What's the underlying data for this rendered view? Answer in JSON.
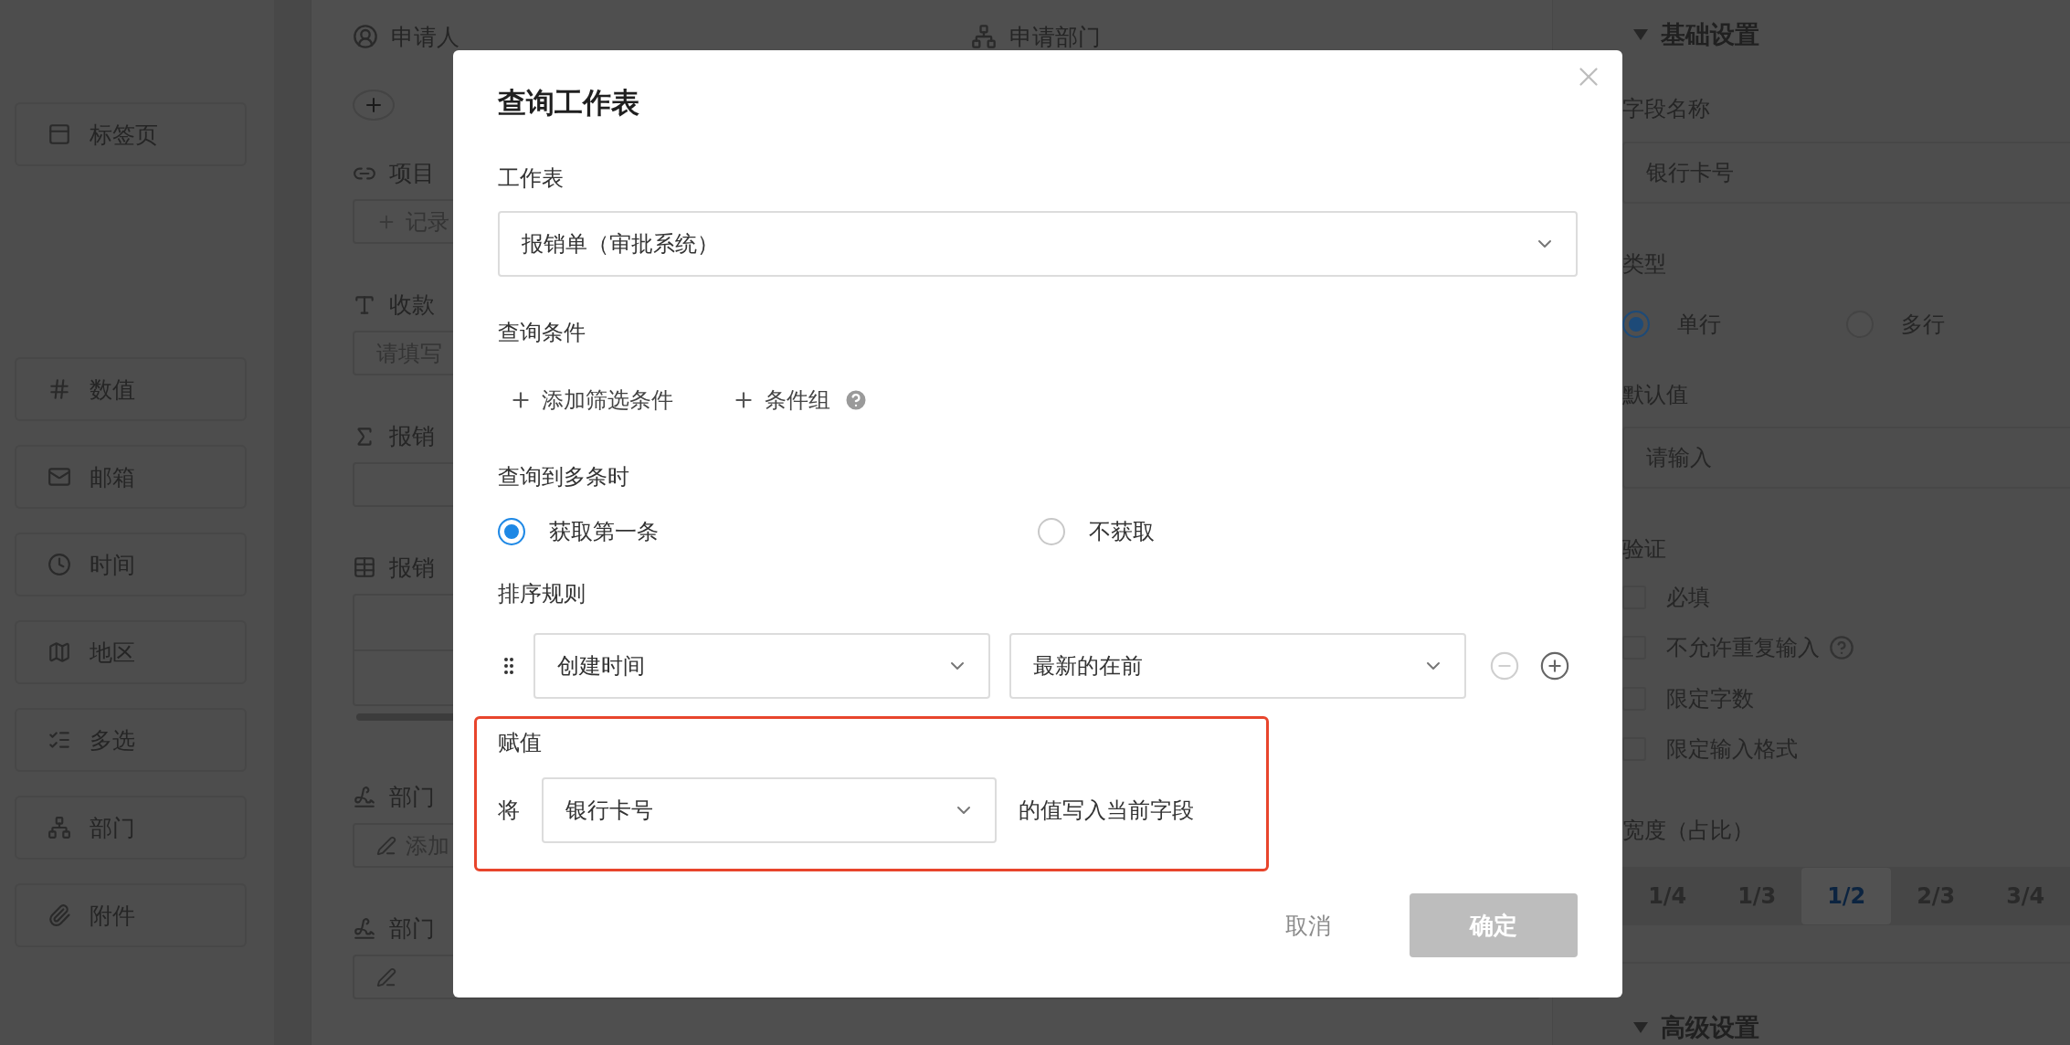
{
  "sidebar": {
    "items": [
      {
        "label": "标签页"
      },
      {
        "label": "数值"
      },
      {
        "label": "邮箱"
      },
      {
        "label": "时间"
      },
      {
        "label": "地区"
      },
      {
        "label": "多选"
      },
      {
        "label": "部门"
      },
      {
        "label": "附件"
      }
    ]
  },
  "form": {
    "header_fields": [
      {
        "label": "申请人"
      },
      {
        "label": "申请部门"
      }
    ],
    "fields": [
      {
        "kind": "relation",
        "label": "项目",
        "button": "记录"
      },
      {
        "kind": "text",
        "label": "收款",
        "placeholder": "请填写"
      },
      {
        "kind": "formula",
        "label": "报销"
      },
      {
        "kind": "table",
        "label": "报销"
      },
      {
        "kind": "signature",
        "label": "部门",
        "button": "添加"
      },
      {
        "kind": "signature",
        "label": "部门"
      }
    ]
  },
  "dialog": {
    "title": "查询工作表",
    "sheet": {
      "label": "工作表",
      "value": "报销单（审批系统）"
    },
    "conditions": {
      "label": "查询条件",
      "actions": [
        {
          "label": "添加筛选条件",
          "help": false
        },
        {
          "label": "条件组",
          "help": true
        }
      ]
    },
    "multiple": {
      "label": "查询到多条时",
      "options": [
        {
          "label": "获取第一条",
          "selected": true
        },
        {
          "label": "不获取",
          "selected": false
        }
      ]
    },
    "sort": {
      "label": "排序规则",
      "field": "创建时间",
      "order": "最新的在前",
      "remove_disabled": true
    },
    "assign": {
      "label": "赋值",
      "prefix": "将",
      "field": "银行卡号",
      "suffix": "的值写入当前字段",
      "highlighted": true
    },
    "buttons": {
      "cancel": "取消",
      "confirm": "确定",
      "confirm_disabled": true
    }
  },
  "settings": {
    "section": "基础设置",
    "name": {
      "label": "字段名称",
      "value": "银行卡号"
    },
    "type": {
      "label": "类型",
      "options": [
        {
          "label": "单行",
          "selected": true
        },
        {
          "label": "多行",
          "selected": false
        }
      ]
    },
    "default": {
      "label": "默认值",
      "placeholder": "请输入"
    },
    "validation": {
      "label": "验证",
      "options": [
        {
          "label": "必填",
          "checked": false,
          "help": false
        },
        {
          "label": "不允许重复输入",
          "checked": false,
          "help": true
        },
        {
          "label": "限定字数",
          "checked": false,
          "help": false
        },
        {
          "label": "限定输入格式",
          "checked": false,
          "help": false
        }
      ]
    },
    "width": {
      "label": "宽度（占比）",
      "options": [
        {
          "label": "1/4",
          "selected": false
        },
        {
          "label": "1/3",
          "selected": false
        },
        {
          "label": "1/2",
          "selected": true
        },
        {
          "label": "2/3",
          "selected": false
        },
        {
          "label": "3/4",
          "selected": false
        }
      ]
    },
    "advanced": {
      "label": "高级设置"
    }
  }
}
